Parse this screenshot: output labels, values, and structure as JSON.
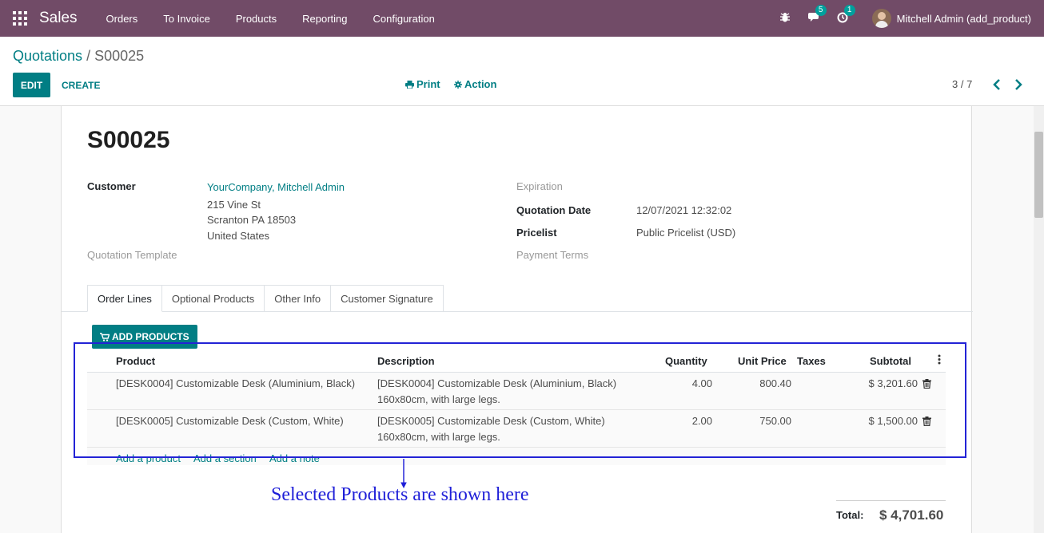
{
  "navbar": {
    "brand": "Sales",
    "menu": [
      "Orders",
      "To Invoice",
      "Products",
      "Reporting",
      "Configuration"
    ],
    "messages_badge": "5",
    "activities_badge": "1",
    "user": "Mitchell Admin (add_product)",
    "bg_color": "#714b67"
  },
  "breadcrumb": {
    "parent": "Quotations",
    "separator": "/",
    "current": "S00025"
  },
  "toolbar": {
    "edit": "EDIT",
    "create": "CREATE",
    "print": "Print",
    "action": "Action",
    "pager": "3 / 7"
  },
  "form": {
    "title": "S00025",
    "customer_label": "Customer",
    "customer_name": "YourCompany, Mitchell Admin",
    "address_line1": "215 Vine St",
    "address_line2": "Scranton PA 18503",
    "address_line3": "United States",
    "quotation_template_label": "Quotation Template",
    "expiration_label": "Expiration",
    "quotation_date_label": "Quotation Date",
    "quotation_date": "12/07/2021 12:32:02",
    "pricelist_label": "Pricelist",
    "pricelist": "Public Pricelist (USD)",
    "payment_terms_label": "Payment Terms"
  },
  "tabs": [
    "Order Lines",
    "Optional Products",
    "Other Info",
    "Customer Signature"
  ],
  "add_products_label": "ADD PRODUCTS",
  "table": {
    "headers": {
      "product": "Product",
      "description": "Description",
      "quantity": "Quantity",
      "unit_price": "Unit Price",
      "taxes": "Taxes",
      "subtotal": "Subtotal"
    },
    "rows": [
      {
        "product": "[DESK0004] Customizable Desk (Aluminium, Black)",
        "desc1": "[DESK0004] Customizable Desk (Aluminium, Black)",
        "desc2": "160x80cm, with large legs.",
        "quantity": "4.00",
        "unit_price": "800.40",
        "taxes": "",
        "subtotal": "$ 3,201.60"
      },
      {
        "product": "[DESK0005] Customizable Desk (Custom, White)",
        "desc1": "[DESK0005] Customizable Desk (Custom, White)",
        "desc2": "160x80cm, with large legs.",
        "quantity": "2.00",
        "unit_price": "750.00",
        "taxes": "",
        "subtotal": "$ 1,500.00"
      }
    ],
    "add_product": "Add a product",
    "add_section": "Add a section",
    "add_note": "Add a note"
  },
  "annotation": "Selected Products are shown here",
  "total": {
    "label": "Total:",
    "value": "$ 4,701.60"
  }
}
